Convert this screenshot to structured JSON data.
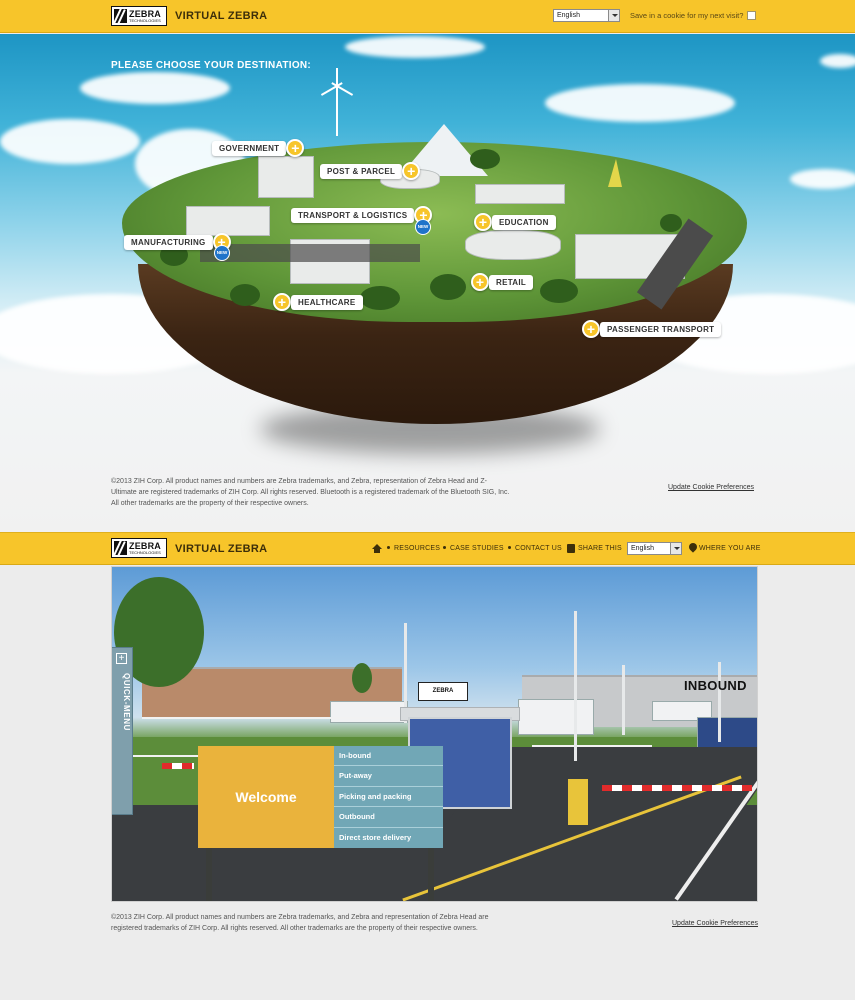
{
  "header": {
    "logo_text": "ZEBRA",
    "logo_sub": "TECHNOLOGIES",
    "site_title": "VIRTUAL ZEBRA",
    "language": "English",
    "cookie_label": "Save in a cookie for my next visit?"
  },
  "hero": {
    "heading": "PLEASE CHOOSE YOUR DESTINATION:",
    "new_badge": "NEW",
    "destinations": [
      {
        "label": "GOVERNMENT"
      },
      {
        "label": "POST & PARCEL"
      },
      {
        "label": "TRANSPORT & LOGISTICS",
        "new": true
      },
      {
        "label": "EDUCATION"
      },
      {
        "label": "MANUFACTURING",
        "new": true
      },
      {
        "label": "RETAIL"
      },
      {
        "label": "HEALTHCARE"
      },
      {
        "label": "PASSENGER TRANSPORT"
      }
    ]
  },
  "footer1": {
    "legal": "©2013 ZIH Corp. All product names and numbers are Zebra trademarks, and Zebra, representation of Zebra Head and Z-Ultimate are registered trademarks of ZIH Corp. All rights reserved. Bluetooth is a registered trademark of the Bluetooth SIG, Inc. All other trademarks are the property of their respective owners.",
    "cookie_link": "Update Cookie Preferences"
  },
  "nav": {
    "site_title": "VIRTUAL ZEBRA",
    "resources": "RESOURCES",
    "case_studies": "CASE STUDIES",
    "contact_us": "CONTACT US",
    "share_this": "SHARE THIS",
    "language": "English",
    "where_you_are": "WHERE YOU ARE"
  },
  "scene": {
    "quick_menu_label": "QUICK-MENU",
    "area_label": "INBOUND",
    "sign_text": "ZEBRA",
    "welcome": "Welcome",
    "menu": [
      "In-bound",
      "Put-away",
      "Picking and packing",
      "Outbound",
      "Direct store delivery"
    ]
  },
  "footer2": {
    "legal": "©2013 ZIH Corp. All product names and numbers are Zebra trademarks, and Zebra and representation of Zebra Head are registered trademarks of ZIH Corp. All rights reserved. All other trademarks are the property of their respective owners.",
    "cookie_link": "Update Cookie Preferences"
  },
  "colors": {
    "brand_yellow": "#f7c52a",
    "welcome_panel": "#eab33c",
    "menu_teal": "#71a7b6",
    "new_badge": "#1f73c9"
  }
}
